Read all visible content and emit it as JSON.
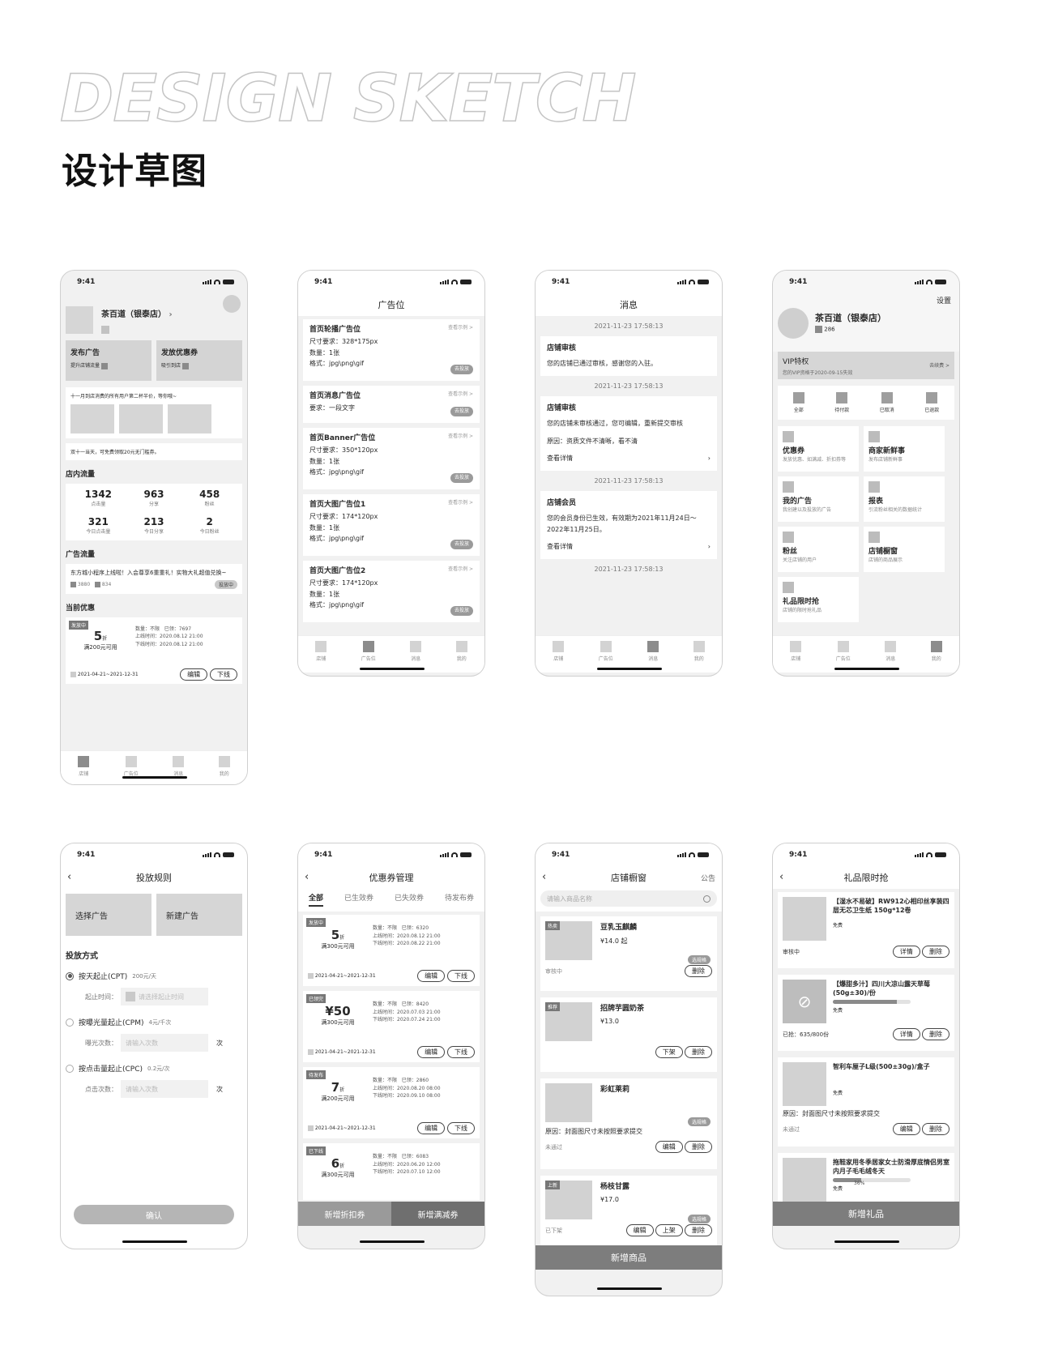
{
  "hero": {
    "title_en": "DESIGN SKETCH",
    "title_cn": "设计草图"
  },
  "status_time": "9:41",
  "tabbar": [
    "店铺",
    "广告位",
    "消息",
    "我的"
  ],
  "home": {
    "shop_name": "茶百道（银泰店）",
    "action1_title": "发布广告",
    "action1_sub": "提升店铺流量",
    "action2_title": "发放优惠券",
    "action2_sub": "吸引到店",
    "notice1": "十一月到店消费的所有用户第二杯半价，等你哦~",
    "notice2": "双十一当天，可免费领取20元无门槛券。",
    "traffic_title": "店内流量",
    "stats": [
      {
        "value": "1342",
        "label": "点击量"
      },
      {
        "value": "963",
        "label": "分享"
      },
      {
        "value": "458",
        "label": "粉丝"
      },
      {
        "value": "321",
        "label": "今日点击量"
      },
      {
        "value": "213",
        "label": "今日分享"
      },
      {
        "value": "2",
        "label": "今日粉丝"
      }
    ],
    "ad_traffic_title": "广告流量",
    "ad_text": "东方城小程序上线啦！入会尊享6重重礼！实物大礼超值兑换~",
    "ad_num1": "3880",
    "ad_num2": "834",
    "ad_status": "投放中",
    "coupon_title": "当前优惠",
    "coupon": {
      "tag": "发放中",
      "value": "5",
      "unit": "折",
      "cond": "满200元可用",
      "qty": "数量：不限",
      "got": "已领：7697",
      "on": "上线时间：2020.08.12  21:00",
      "off": "下线时间：2020.08.12  21:00",
      "range": "2021-04-21~2021-12-31",
      "edit": "编辑",
      "down": "下线"
    }
  },
  "adpos": {
    "title": "广告位",
    "see": "查看示例 >",
    "go": "去投放",
    "items": [
      {
        "name": "首页轮播广告位",
        "l1": "尺寸要求：328*175px",
        "l2": "数量：1张",
        "l3": "格式：jpg\\png\\gif"
      },
      {
        "name": "首页消息广告位",
        "l1": "要求：一段文字",
        "l2": "",
        "l3": ""
      },
      {
        "name": "首页Banner广告位",
        "l1": "尺寸要求：350*120px",
        "l2": "数量：1张",
        "l3": "格式：jpg\\png\\gif"
      },
      {
        "name": "首页大图广告位1",
        "l1": "尺寸要求：174*120px",
        "l2": "数量：1张",
        "l3": "格式：jpg\\png\\gif"
      },
      {
        "name": "首页大图广告位2",
        "l1": "尺寸要求：174*120px",
        "l2": "数量：1张",
        "l3": "格式：jpg\\png\\gif"
      }
    ]
  },
  "messages": {
    "title": "消息",
    "time": "2021-11-23 17:58:13",
    "m1_title": "店铺审核",
    "m1_text": "您的店铺已通过审核，感谢您的入驻。",
    "m2_title": "店铺审核",
    "m2_text": "您的店铺未审核通过，您可编辑，重新提交审核",
    "m2_reason": "原因：资质文件不清晰，看不清",
    "m3_title": "店铺会员",
    "m3_text": "您的会员身份已生效，有效期为2021年11月24日～2022年11月25日。",
    "detail": "查看详情"
  },
  "mine": {
    "settings": "设置",
    "shop_name": "茶百道（银泰店）",
    "count": "286",
    "vip_title": "VIP特权",
    "vip_sub": "您的VIP资格于2020-09-15失效",
    "vip_action": "去续费 >",
    "orders": [
      "全部",
      "待付款",
      "已取消",
      "已退款"
    ],
    "cells": [
      {
        "t": "优惠券",
        "s": "发放优惠、如满减、折扣券等"
      },
      {
        "t": "商家新鲜事",
        "s": "发布店铺新鲜事"
      },
      {
        "t": "我的广告",
        "s": "我创建以及投放的广告"
      },
      {
        "t": "报表",
        "s": "引流粉丝相关的数据统计"
      },
      {
        "t": "粉丝",
        "s": "关注店铺的用户"
      },
      {
        "t": "店铺橱窗",
        "s": "店铺的商品展示"
      },
      {
        "t": "礼品限时抢",
        "s": "店铺的限时抢礼品"
      }
    ]
  },
  "rules": {
    "title": "投放规则",
    "btn1": "选择广告",
    "btn2": "新建广告",
    "method_title": "投放方式",
    "opt1": "按天起止(CPT)",
    "opt1_price": "200元/天",
    "opt1_field": "起止时间：",
    "opt1_ph": "请选择起止时间",
    "opt2": "按曝光量起止(CPM)",
    "opt2_price": "4元/千次",
    "opt2_field": "曝光次数：",
    "opt2_ph": "请输入次数",
    "opt2_unit": "次",
    "opt3": "按点击量起止(CPC)",
    "opt3_price": "0.2元/次",
    "opt3_field": "点击次数：",
    "opt3_ph": "请输入次数",
    "opt3_unit": "次",
    "confirm": "确认"
  },
  "coupons": {
    "title": "优惠券管理",
    "tabs": [
      "全部",
      "已生效券",
      "已失效券",
      "待发布券"
    ],
    "items": [
      {
        "tag": "发放中",
        "value": "5",
        "unit": "折",
        "cond": "满300元可用",
        "qty": "数量：不限",
        "got": "已领：6320",
        "on": "上线时间：2020.08.12  21:00",
        "off": "下线时间：2020.08.22  21:00"
      },
      {
        "tag": "已领完",
        "value": "¥50",
        "unit": "",
        "cond": "满300元可用",
        "qty": "数量：不限",
        "got": "已领：8420",
        "on": "上线时间：2020.07.03  21:00",
        "off": "下线时间：2020.07.24  21:00"
      },
      {
        "tag": "待发布",
        "value": "7",
        "unit": "折",
        "cond": "满200元可用",
        "qty": "数量：不限",
        "got": "已领：2860",
        "on": "上线时间：2020.08.20  08:00",
        "off": "下线时间：2020.09.10  08:00"
      },
      {
        "tag": "已下线",
        "value": "6",
        "unit": "折",
        "cond": "满300元可用",
        "qty": "数量：不限",
        "got": "已领：6083",
        "on": "上线时间：2020.06.20  12:00",
        "off": "下线时间：2020.07.10  12:00"
      }
    ],
    "range": "2021-04-21~2021-12-31",
    "edit": "编辑",
    "down": "下线",
    "btn1": "新增折扣券",
    "btn2": "新增满减券"
  },
  "window": {
    "title": "店铺橱窗",
    "right": "公告",
    "search_ph": "请输入商品名称",
    "spec": "选规格",
    "items": [
      {
        "tag": "热卖",
        "name": "豆乳玉麒麟",
        "price": "¥14.0 起",
        "status": "审核中",
        "btns": [
          "删除"
        ]
      },
      {
        "tag": "推荐",
        "name": "招牌芋圆奶茶",
        "price": "¥13.0",
        "status": "",
        "btns": [
          "下架",
          "删除"
        ]
      },
      {
        "tag": "",
        "name": "彩虹莱莉",
        "price": "",
        "reason": "原因：封面图尺寸未按照要求提交",
        "status": "未通过",
        "btns": [
          "编辑",
          "删除"
        ]
      },
      {
        "tag": "上新",
        "name": "杨枝甘露",
        "price": "¥17.0",
        "status": "已下架",
        "btns": [
          "编辑",
          "上架",
          "删除"
        ]
      }
    ],
    "add": "新增商品"
  },
  "gifts": {
    "title": "礼品限时抢",
    "items": [
      {
        "name": "【湿水不易破】RW912心相印丝享装四层无芯卫生纸 150g*12卷",
        "price": "免费",
        "status": "审核中",
        "btns": [
          "详情",
          "删除"
        ]
      },
      {
        "name": "【爆甜多汁】四川大凉山露天草莓(50g±30)/份",
        "price": "免费",
        "progress": "82%",
        "status": "已抢：635/800份",
        "btns": [
          "详情",
          "删除"
        ]
      },
      {
        "name": "智利车厘子L级(500±30g)/盒子",
        "price": "免费",
        "reason": "原因：封面图尺寸未按照要求提交",
        "status": "未通过",
        "btns": [
          "编辑",
          "删除"
        ]
      },
      {
        "name": "拖鞋家用冬季居家女士防滑厚底情侣男室内月子毛毛绒冬天",
        "price": "免费",
        "progress": "36%"
      }
    ],
    "add": "新增礼品"
  }
}
